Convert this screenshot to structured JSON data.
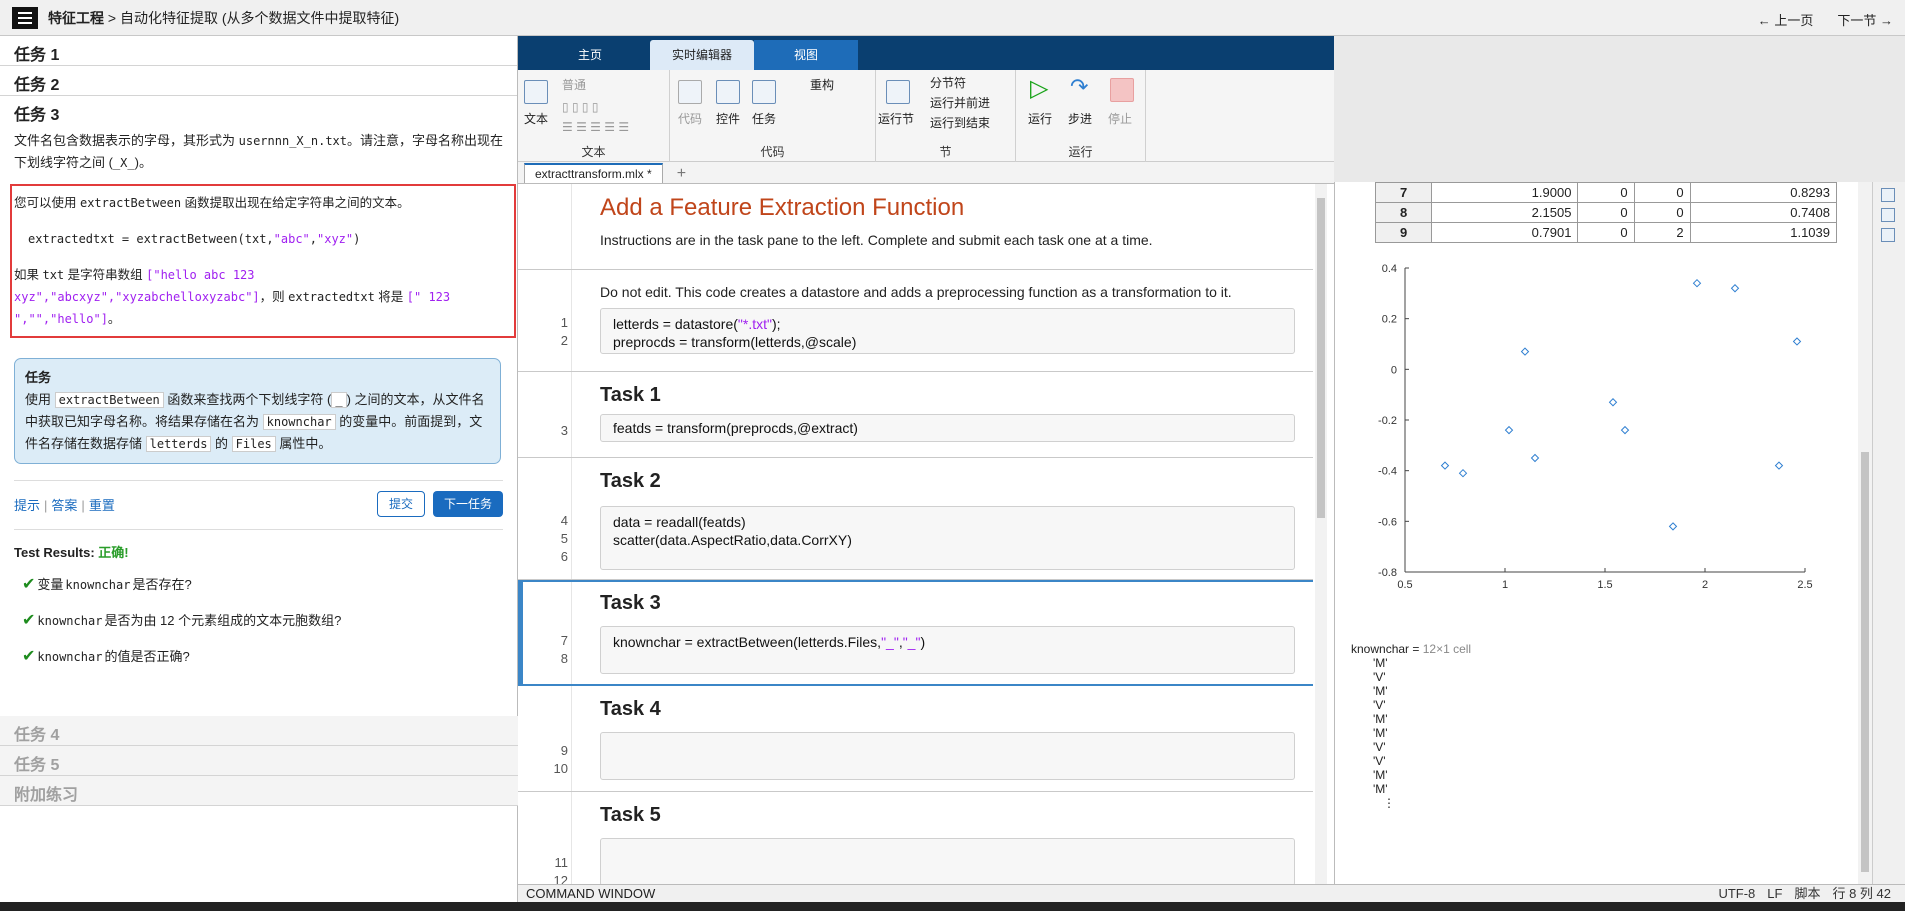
{
  "topbar": {
    "crumb_bold": "特征工程",
    "crumb_rest": " > 自动化特征提取 (从多个数据文件中提取特征)",
    "prev": "← 上一页",
    "next": "下一节 →"
  },
  "left": {
    "task1": "任务 1",
    "task2": "任务 2",
    "task3": "任务 3",
    "t3desc_a": "文件名包含数据表示的字母，其形式为 ",
    "t3desc_code": "usernnn_X_n.txt",
    "t3desc_b": "。请注意，字母名称出现在下划线字符之间 (",
    "t3desc_code2": "_X_",
    "t3desc_c": ")。",
    "info_a": "您可以使用 ",
    "info_fn": "extractBetween",
    "info_b": " 函数提取出现在给定字符串之间的文本。",
    "info_code_a": "extractedtxt = extractBetween(txt,",
    "info_code_s1": "\"abc\"",
    "info_code_comma": ",",
    "info_code_s2": "\"xyz\"",
    "info_code_end": ")",
    "info_c": "如果 ",
    "info_txt": "txt",
    "info_d": " 是字符串数组 ",
    "info_arr1": "[\"hello abc 123 xyz\",\"abcxyz\",\"xyzabchelloxyzabc\"]",
    "info_e": "，则 ",
    "info_ex": "extractedtxt",
    "info_f": " 将是 ",
    "info_arr2": "[\" 123 \",\"\",\"hello\"]",
    "info_g": "。",
    "task_title": "任务",
    "task_a": "使用 ",
    "task_fn": "extractBetween",
    "task_b": " 函数来查找两个下划线字符 (",
    "task_us": "_",
    "task_c": ") 之间的文本，从文件名中获取已知字母名称。将结果存储在名为 ",
    "task_var": "knownchar",
    "task_d": " 的变量中。前面提到，文件名存储在数据存储 ",
    "task_ds": "letterds",
    "task_e": " 的 ",
    "task_prop": "Files",
    "task_f": " 属性中。",
    "hint": "提示",
    "answer": "答案",
    "reset": "重置",
    "submit": "提交",
    "next_task": "下一任务",
    "results_label": "Test Results:",
    "results_ok": "正确!",
    "check1_a": "变量 ",
    "check1_var": "knownchar",
    "check1_b": " 是否存在?",
    "check2_var": "knownchar",
    "check2_b": " 是否为由 12 个元素组成的文本元胞数组?",
    "check3_var": "knownchar",
    "check3_b": " 的值是否正确?",
    "task4": "任务 4",
    "task5": "任务 5",
    "extra": "附加练习"
  },
  "tabs": {
    "home": "主页",
    "live": "实时编辑器",
    "view": "视图"
  },
  "ribbon": {
    "text_btn": "文本",
    "normal": "普通",
    "grp_text": "文本",
    "code_btn": "代码",
    "control_btn": "控件",
    "task_btn": "任务",
    "refactor": "重构",
    "grp_code": "代码",
    "run_section": "运行节",
    "section_break": "分节符",
    "run_advance": "运行并前进",
    "run_to_end": "运行到结束",
    "grp_section": "节",
    "run": "运行",
    "step": "步进",
    "stop": "停止",
    "grp_run": "运行"
  },
  "doc": {
    "tab": "extracttransform.mlx *",
    "plus": "+"
  },
  "editor": {
    "title": "Add a Feature Extraction Function",
    "intro": "Instructions are in the task pane to the left. Complete and submit each task one at a time.",
    "note": "Do not edit. This code creates a datastore and adds a preprocessing function as a transformation to it.",
    "l1a": "letterds = datastore(",
    "l1s": "\"*.txt\"",
    "l1b": ");",
    "l2": "preprocds = transform(letterds,@scale)",
    "task1": "Task 1",
    "l3": "featds = transform(preprocds,@extract)",
    "task2": "Task 2",
    "l4": "data = readall(featds)",
    "l5": "scatter(data.AspectRatio,data.CorrXY)",
    "task3": "Task 3",
    "l7a": "knownchar = extractBetween(letterds.Files,",
    "l7s1": "\"_\"",
    "l7c": ",",
    "l7s2": "\"_\"",
    "l7b": ")",
    "task4": "Task 4",
    "task5": "Task 5",
    "ln": [
      "1",
      "2",
      "3",
      "4",
      "5",
      "6",
      "7",
      "8",
      "9",
      "10",
      "11",
      "12"
    ]
  },
  "output": {
    "table": [
      [
        "7",
        "1.9000",
        "0",
        "0",
        "0.8293"
      ],
      [
        "8",
        "2.1505",
        "0",
        "0",
        "0.7408"
      ],
      [
        "9",
        "0.7901",
        "0",
        "2",
        "1.1039"
      ]
    ],
    "var_label": "knownchar =",
    "var_type": "12×1 cell",
    "values": [
      "'M'",
      "'V'",
      "'M'",
      "'V'",
      "'M'",
      "'M'",
      "'V'",
      "'V'",
      "'M'",
      "'M'"
    ],
    "ellipsis": "⋮"
  },
  "chart_data": {
    "type": "scatter",
    "title": "",
    "xlabel": "",
    "ylabel": "",
    "xlim": [
      0.5,
      2.5
    ],
    "ylim": [
      -0.8,
      0.4
    ],
    "xticks": [
      "0.5",
      "1",
      "1.5",
      "2",
      "2.5"
    ],
    "yticks": [
      "0.4",
      "0.2",
      "0",
      "-0.2",
      "-0.4",
      "-0.6",
      "-0.8"
    ],
    "points": [
      {
        "x": 0.7,
        "y": -0.38
      },
      {
        "x": 0.79,
        "y": -0.41
      },
      {
        "x": 1.02,
        "y": -0.24
      },
      {
        "x": 1.1,
        "y": 0.07
      },
      {
        "x": 1.15,
        "y": -0.35
      },
      {
        "x": 1.54,
        "y": -0.13
      },
      {
        "x": 1.6,
        "y": -0.24
      },
      {
        "x": 1.84,
        "y": -0.62
      },
      {
        "x": 1.96,
        "y": 0.34
      },
      {
        "x": 2.15,
        "y": 0.32
      },
      {
        "x": 2.37,
        "y": -0.38
      },
      {
        "x": 2.46,
        "y": 0.11
      }
    ],
    "color": "#2f7fd1",
    "marker": "diamond"
  },
  "status": {
    "cw": "COMMAND WINDOW",
    "enc": "UTF-8",
    "lf": "LF",
    "script": "脚本",
    "pos": "行 8 列 42"
  }
}
